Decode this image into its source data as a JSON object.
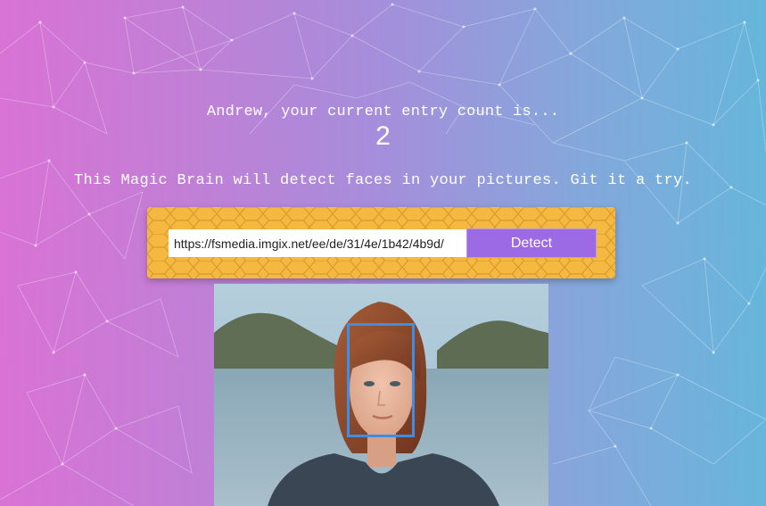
{
  "user": {
    "entry_label": "Andrew, your current entry count is...",
    "entry_count": "2"
  },
  "intro": {
    "text": "This Magic Brain will detect faces in your pictures. Git it a try."
  },
  "form": {
    "url_value": "https://fsmedia.imgix.net/ee/de/31/4e/1b42/4b9d/",
    "detect_label": "Detect"
  },
  "colors": {
    "gradient_left": "#da72d6",
    "gradient_right": "#66b6dc",
    "panel": "#f5b942",
    "button": "#9d6ae6",
    "face_box": "#3f8de4"
  }
}
